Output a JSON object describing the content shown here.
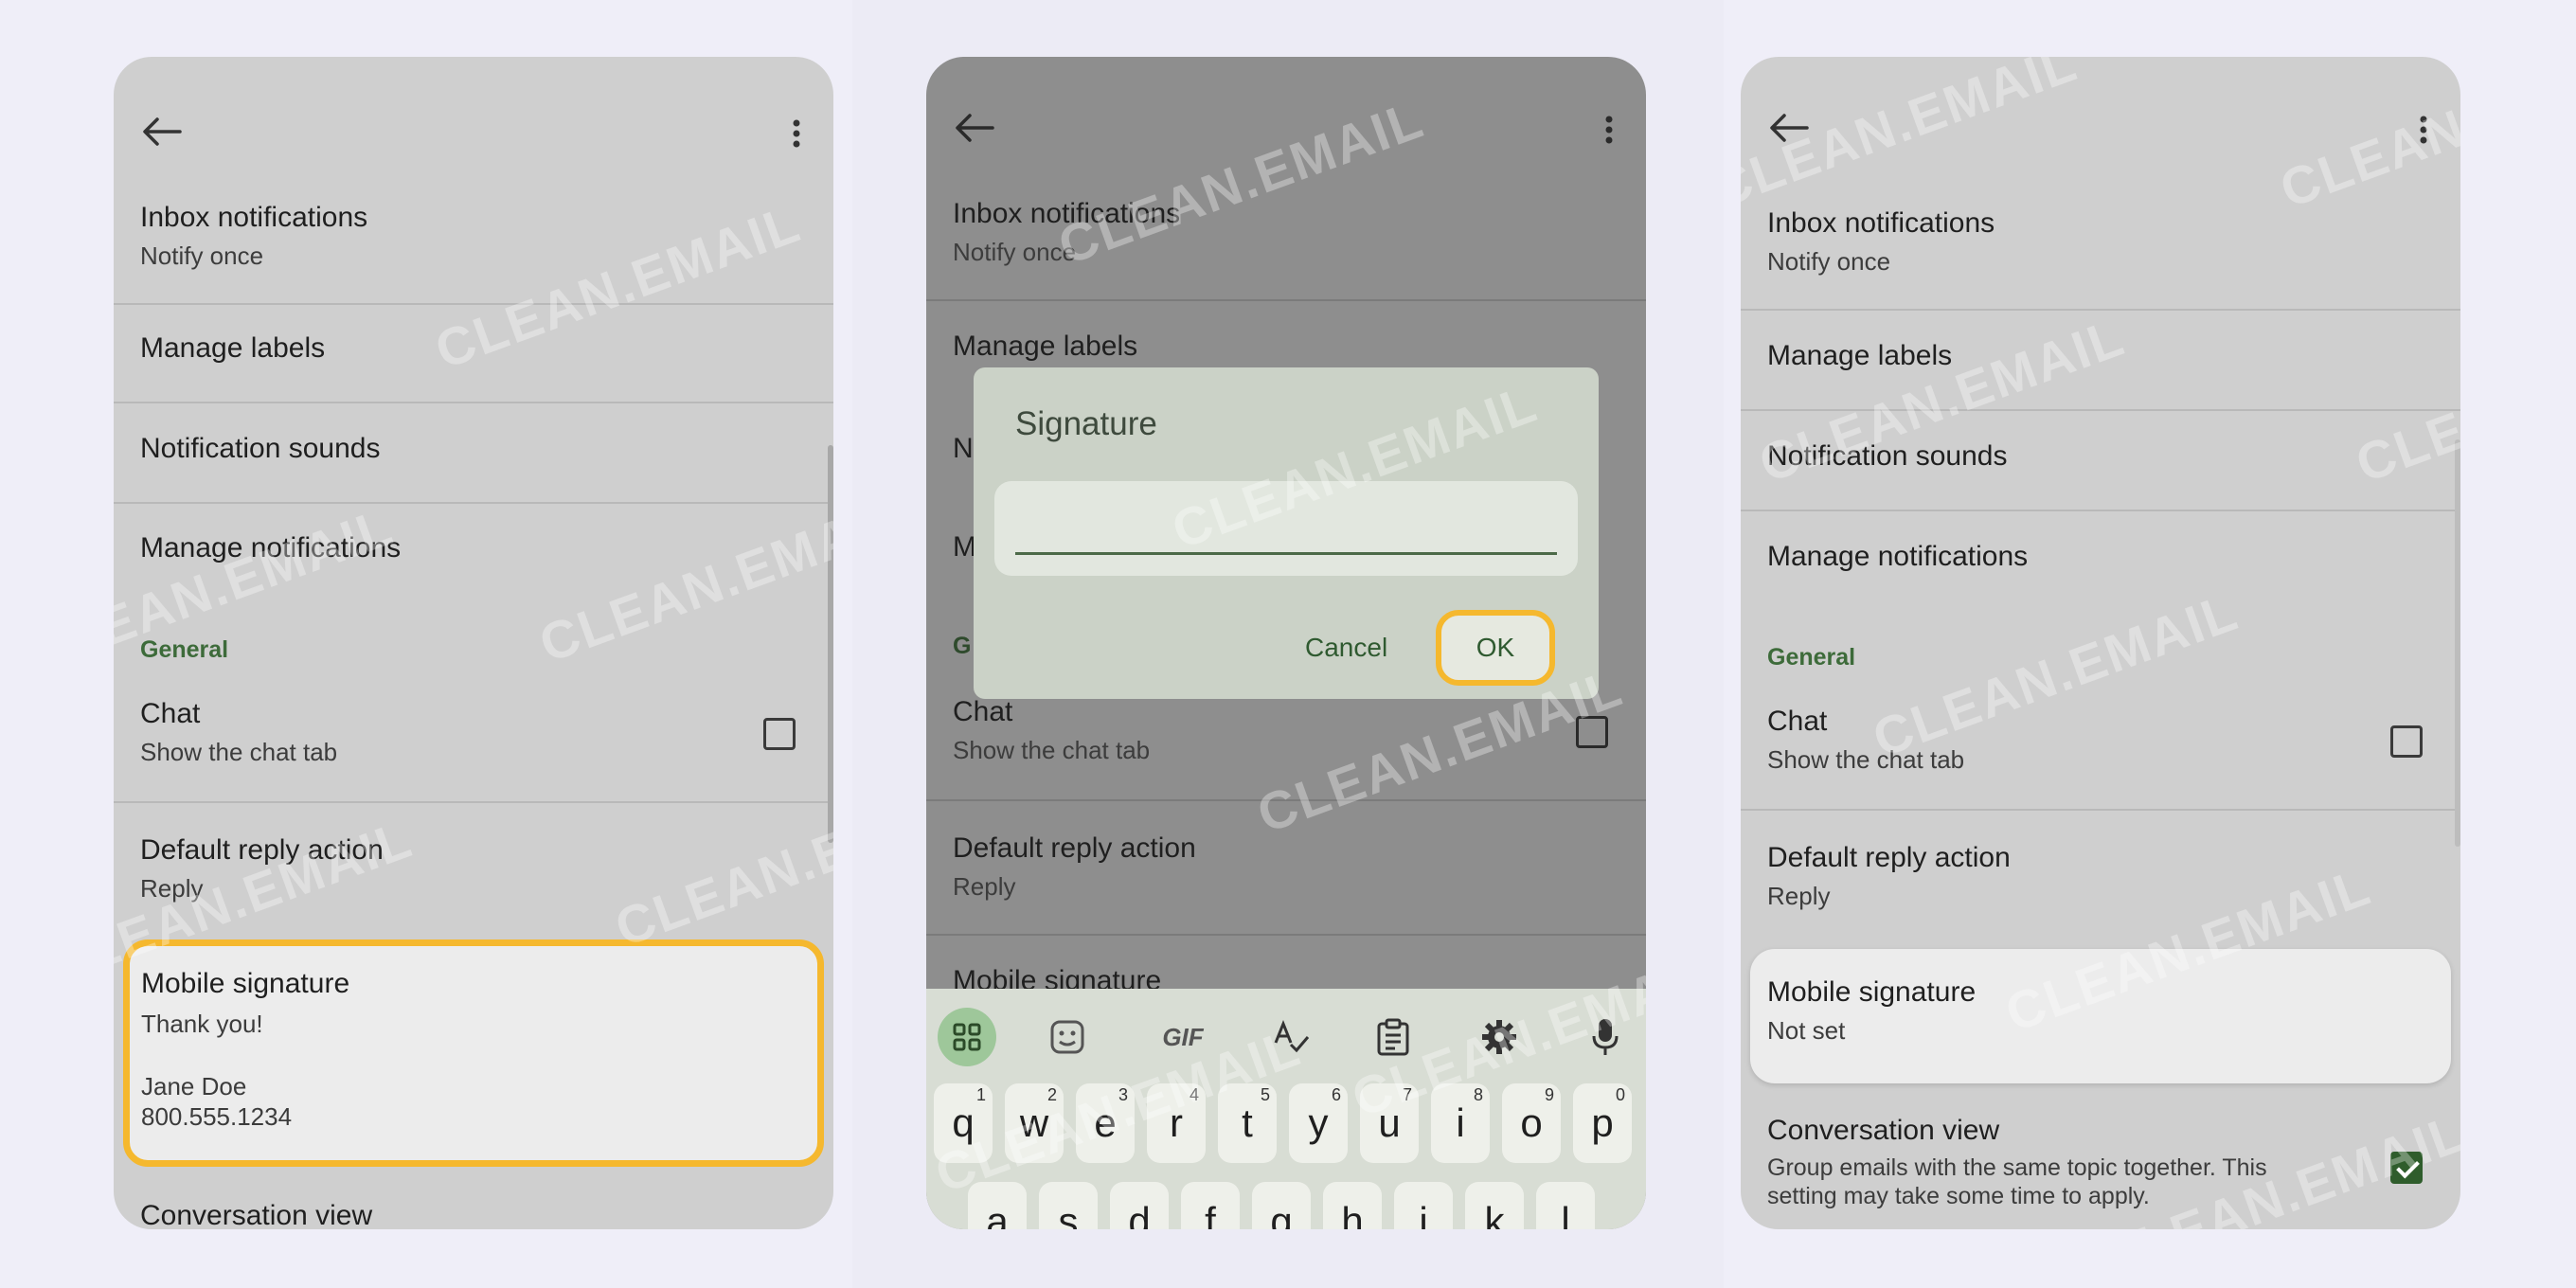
{
  "watermark": "CLEAN.EMAIL",
  "colors": {
    "highlight": "#f5b82e",
    "section": "#3d6b3a",
    "checked": "#2f5d2c"
  },
  "screen1": {
    "inbox_notifications": {
      "title": "Inbox notifications",
      "subtitle": "Notify once"
    },
    "manage_labels": "Manage labels",
    "notification_sounds": "Notification sounds",
    "manage_notifications": "Manage notifications",
    "section_general": "General",
    "chat": {
      "title": "Chat",
      "subtitle": "Show the chat tab",
      "checked": false
    },
    "default_reply": {
      "title": "Default reply action",
      "subtitle": "Reply"
    },
    "mobile_signature": {
      "title": "Mobile signature",
      "line1": "Thank you!",
      "line2": "Jane Doe",
      "line3": "800.555.1234"
    },
    "conversation_view": "Conversation view"
  },
  "screen2": {
    "inbox_notifications": {
      "title": "Inbox notifications",
      "subtitle": "Notify once"
    },
    "manage_labels": "Manage labels",
    "notification_sounds_partial": "N",
    "manage_notifications_partial": "M",
    "section_general_partial": "G",
    "chat": {
      "title": "Chat",
      "subtitle": "Show the chat tab",
      "checked": false
    },
    "default_reply": {
      "title": "Default reply action",
      "subtitle": "Reply"
    },
    "mobile_signature": "Mobile signature",
    "dialog": {
      "title": "Signature",
      "input_value": "",
      "cancel": "Cancel",
      "ok": "OK"
    },
    "keyboard": {
      "toolbar": [
        "apps-grid-icon",
        "sticker-icon",
        "GIF",
        "spellcheck-icon",
        "clipboard-icon",
        "settings-gear-icon",
        "microphone-icon"
      ],
      "gif_label": "GIF",
      "row1": [
        {
          "k": "q",
          "n": "1"
        },
        {
          "k": "w",
          "n": "2"
        },
        {
          "k": "e",
          "n": "3"
        },
        {
          "k": "r",
          "n": "4"
        },
        {
          "k": "t",
          "n": "5"
        },
        {
          "k": "y",
          "n": "6"
        },
        {
          "k": "u",
          "n": "7"
        },
        {
          "k": "i",
          "n": "8"
        },
        {
          "k": "o",
          "n": "9"
        },
        {
          "k": "p",
          "n": "0"
        }
      ],
      "row2": [
        "a",
        "s",
        "d",
        "f",
        "g",
        "h",
        "j",
        "k",
        "l"
      ]
    }
  },
  "screen3": {
    "inbox_notifications": {
      "title": "Inbox notifications",
      "subtitle": "Notify once"
    },
    "manage_labels": "Manage labels",
    "notification_sounds": "Notification sounds",
    "manage_notifications": "Manage notifications",
    "section_general": "General",
    "chat": {
      "title": "Chat",
      "subtitle": "Show the chat tab",
      "checked": false
    },
    "default_reply": {
      "title": "Default reply action",
      "subtitle": "Reply"
    },
    "mobile_signature": {
      "title": "Mobile signature",
      "subtitle": "Not set"
    },
    "conversation_view": {
      "title": "Conversation view",
      "subtitle_line1": "Group emails with the same topic together. This",
      "subtitle_line2": "setting may take some time to apply.",
      "checked": true
    }
  }
}
